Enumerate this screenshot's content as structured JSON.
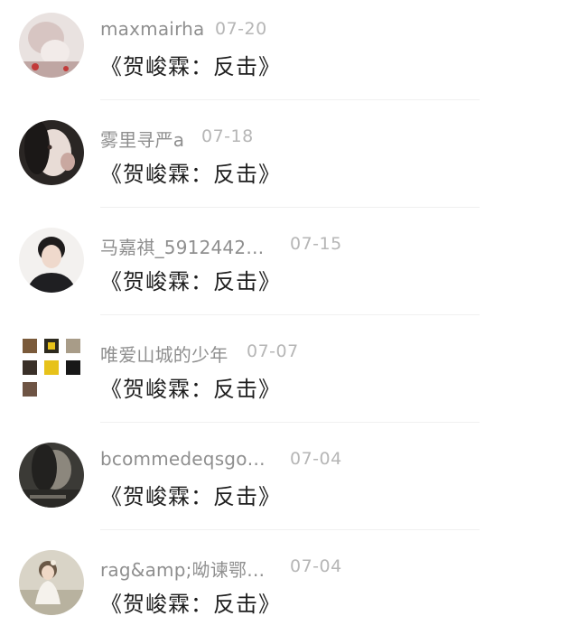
{
  "comments": [
    {
      "username": "maxmairha",
      "date": "07-20",
      "text": "《贺峻霖：反击》",
      "avatar_icon": "avatar-photo"
    },
    {
      "username": "雾里寻严a",
      "date": "07-18",
      "text": "《贺峻霖：反击》",
      "avatar_icon": "avatar-photo"
    },
    {
      "username": "马嘉祺_5912442…",
      "date": "07-15",
      "text": "《贺峻霖：反击》",
      "avatar_icon": "avatar-photo"
    },
    {
      "username": "唯爱山城的少年",
      "date": "07-07",
      "text": "《贺峻霖：反击》",
      "avatar_icon": "avatar-grid"
    },
    {
      "username": "bcommedeqsgo…",
      "date": "07-04",
      "text": "《贺峻霖：反击》",
      "avatar_icon": "avatar-photo"
    },
    {
      "username": "rag&amp;呦谏鄂…",
      "date": "07-04",
      "text": "《贺峻霖：反击》",
      "avatar_icon": "avatar-photo"
    }
  ],
  "colors": {
    "username": "#8f8f8f",
    "date": "#b6b6b6",
    "text": "#1e1e1e",
    "divider": "#f0f0f0"
  }
}
